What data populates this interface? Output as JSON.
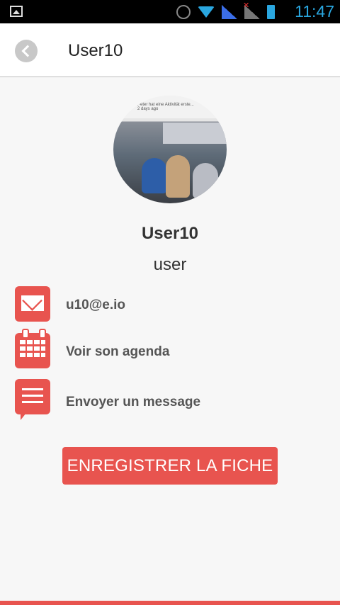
{
  "status_bar": {
    "time": "11:47"
  },
  "header": {
    "title": "User10"
  },
  "profile": {
    "name": "User10",
    "role": "user",
    "photo_caption": "Peter hat eine Aktivität erste...",
    "photo_time": "2 days ago"
  },
  "actions": [
    {
      "icon": "envelope-icon",
      "label": "u10@e.io"
    },
    {
      "icon": "calendar-icon",
      "label": "Voir son agenda"
    },
    {
      "icon": "message-icon",
      "label": "Envoyer un message"
    }
  ],
  "buttons": {
    "save": "ENREGISTRER LA FICHE"
  },
  "colors": {
    "accent": "#e8544f",
    "status_time": "#2aa7e0"
  }
}
